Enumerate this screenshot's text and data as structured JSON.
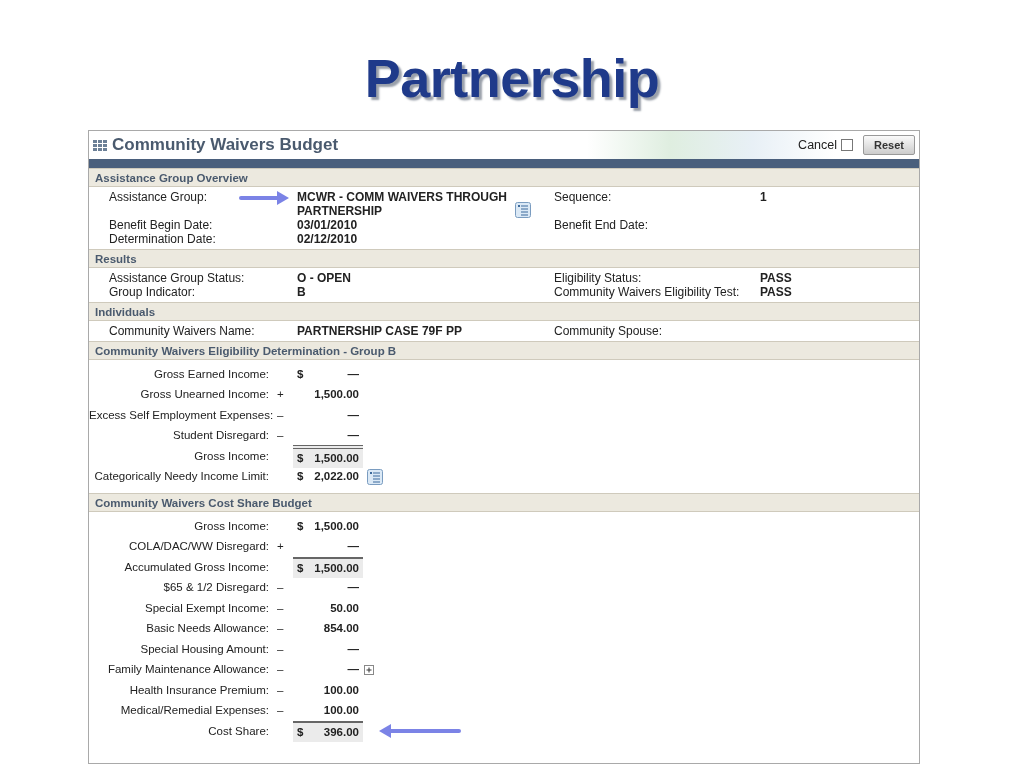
{
  "slide_title": "Partnership",
  "panel": {
    "title": "Community Waivers Budget",
    "cancel": {
      "label": "Cancel",
      "checked": false
    },
    "reset_button": "Reset"
  },
  "sections": [
    {
      "kind": "grid",
      "title": "Assistance Group Overview",
      "rows": [
        {
          "label": "Assistance Group:",
          "value": "MCWR - COMM WAIVERS THROUGH PARTNERSHIP",
          "note_icon": true,
          "arrow": true,
          "label_2": "Sequence:",
          "value_2": "1"
        },
        {
          "label": "Benefit Begin Date:",
          "value": "03/01/2010",
          "label_2": "Benefit End Date:"
        },
        {
          "label": "Determination Date:",
          "value": "02/12/2010"
        }
      ]
    },
    {
      "kind": "grid",
      "title": "Results",
      "rows": [
        {
          "label": "Assistance Group Status:",
          "value": "O - OPEN",
          "label_2": "Eligibility Status:",
          "value_2": "PASS"
        },
        {
          "label": "Group Indicator:",
          "value": "B",
          "label_2": "Community Waivers Eligibility Test:",
          "value_2": "PASS"
        }
      ]
    },
    {
      "kind": "grid",
      "title": "Individuals",
      "rows": [
        {
          "label": "Community Waivers Name:",
          "value": "PARTNERSHIP CASE 79F PP",
          "label_2": "Community Spouse:"
        }
      ]
    },
    {
      "kind": "ledger",
      "title": "Community Waivers Eligibility Determination - Group B",
      "rows": [
        {
          "kind": "line",
          "label": "Gross Earned Income:",
          "currency": "$",
          "amount": "—"
        },
        {
          "kind": "line",
          "label": "Gross Unearned Income:",
          "sign": "+",
          "amount": "1,500.00"
        },
        {
          "kind": "line",
          "label": "Excess Self Employment Expenses:",
          "sign": "–",
          "amount": "—"
        },
        {
          "kind": "line",
          "label": "Student Disregard:",
          "sign": "–",
          "amount": "—"
        },
        {
          "kind": "double_total",
          "label": "Gross Income:",
          "currency": "$",
          "amount": "1,500.00"
        },
        {
          "kind": "line",
          "label": "Categorically Needy Income Limit:",
          "currency": "$",
          "amount": "2,022.00",
          "note_icon": true
        }
      ]
    },
    {
      "kind": "ledger",
      "title": "Community Waivers Cost Share Budget",
      "rows": [
        {
          "kind": "line",
          "label": "Gross Income:",
          "currency": "$",
          "amount": "1,500.00"
        },
        {
          "kind": "line",
          "label": "COLA/DAC/WW Disregard:",
          "sign": "+",
          "amount": "—"
        },
        {
          "kind": "total",
          "label": "Accumulated Gross Income:",
          "currency": "$",
          "amount": "1,500.00"
        },
        {
          "kind": "line",
          "label": "$65 & 1/2 Disregard:",
          "sign": "–",
          "amount": "—"
        },
        {
          "kind": "line",
          "label": "Special Exempt Income:",
          "sign": "–",
          "amount": "50.00"
        },
        {
          "kind": "line",
          "label": "Basic Needs Allowance:",
          "sign": "–",
          "amount": "854.00"
        },
        {
          "kind": "line",
          "label": "Special Housing Amount:",
          "sign": "–",
          "amount": "—"
        },
        {
          "kind": "line",
          "label": "Family Maintenance Allowance:",
          "sign": "–",
          "amount": "—",
          "expand_icon": true
        },
        {
          "kind": "line",
          "label": "Health Insurance Premium:",
          "sign": "–",
          "amount": "100.00"
        },
        {
          "kind": "line",
          "label": "Medical/Remedial Expenses:",
          "sign": "–",
          "amount": "100.00"
        },
        {
          "kind": "total",
          "label": "Cost Share:",
          "currency": "$",
          "amount": "396.00",
          "arrow": true
        }
      ]
    }
  ]
}
